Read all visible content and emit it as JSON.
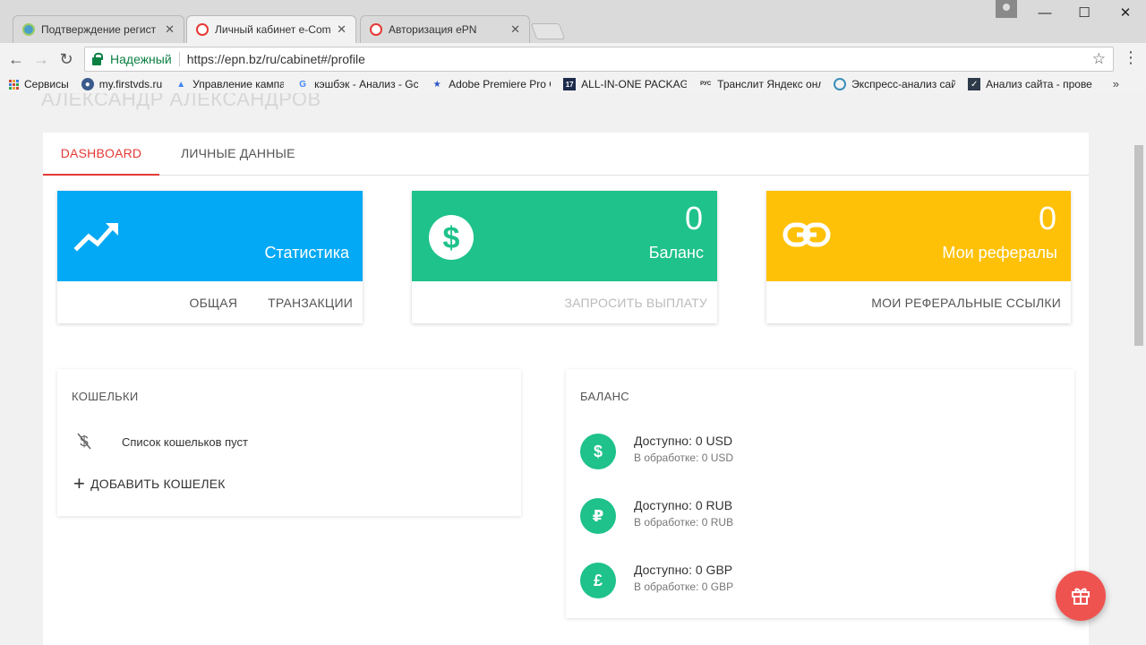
{
  "browser": {
    "tabs": [
      {
        "title": "Подтверждение регист",
        "favicon_color": "#4a9fc8"
      },
      {
        "title": "Личный кабинет e-Com",
        "favicon_color": "#e53935"
      },
      {
        "title": "Авторизация ePN",
        "favicon_color": "#e53935"
      }
    ],
    "close_glyph": "✕",
    "secure_label": "Надежный",
    "url": "https://epn.bz/ru/cabinet#/profile",
    "bookmarks": [
      {
        "label": "Сервисы",
        "icon": "apps-icon"
      },
      {
        "label": "my.firstvds.ru",
        "icon": "globe-icon"
      },
      {
        "label": "Управление кампани",
        "icon": "adwords-icon"
      },
      {
        "label": "кэшбэк - Анализ - Gc",
        "icon": "google-icon"
      },
      {
        "label": "Adobe Premiere Pro C",
        "icon": "premiere-icon"
      },
      {
        "label": "ALL-IN-ONE PACKAGE",
        "icon": "calendar-icon"
      },
      {
        "label": "Транслит Яндекс онл",
        "icon": "translit-icon"
      },
      {
        "label": "Экспресс-анализ сай",
        "icon": "analysis-icon"
      },
      {
        "label": "Анализ сайта - прове",
        "icon": "check-icon"
      }
    ],
    "bookmarks_more": "»",
    "win_minimize": "—",
    "win_maximize": "☐",
    "win_close": "✕"
  },
  "page": {
    "ghost_name": "АЛЕКСАНДР АЛЕКСАНДРОВ",
    "tabs": [
      {
        "label": "DASHBOARD",
        "active": true
      },
      {
        "label": "ЛИЧНЫЕ ДАННЫЕ",
        "active": false
      }
    ],
    "cards": {
      "stats": {
        "label": "Статистика",
        "color": "#03a9f4",
        "actions": [
          "ОБЩАЯ",
          "ТРАНЗАКЦИИ"
        ]
      },
      "balance": {
        "value": "0",
        "label": "Баланс",
        "color": "#1ec28a",
        "action": "ЗАПРОСИТЬ ВЫПЛАТУ"
      },
      "referrals": {
        "value": "0",
        "label": "Мои рефералы",
        "color": "#ffc107",
        "action": "МОИ РЕФЕРАЛЬНЫЕ ССЫЛКИ"
      }
    },
    "wallets": {
      "title": "КОШЕЛЬКИ",
      "empty_text": "Список кошельков пуст",
      "add_label": "ДОБАВИТЬ КОШЕЛЕК"
    },
    "balance_panel": {
      "title": "БАЛАНС",
      "rows": [
        {
          "symbol": "$",
          "available": "Доступно: 0 USD",
          "pending": "В обработке: 0 USD"
        },
        {
          "symbol": "₽",
          "available": "Доступно: 0 RUB",
          "pending": "В обработке: 0 RUB"
        },
        {
          "symbol": "£",
          "available": "Доступно: 0 GBP",
          "pending": "В обработке: 0 GBP"
        }
      ]
    }
  }
}
